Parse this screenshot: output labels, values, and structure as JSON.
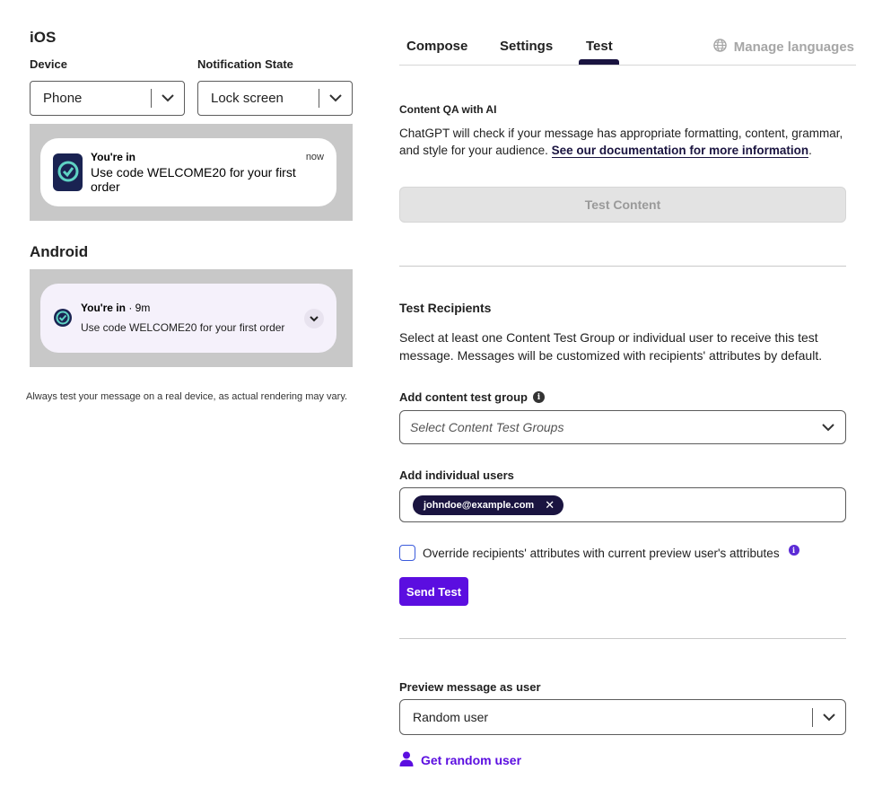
{
  "ios": {
    "title": "iOS",
    "device_label": "Device",
    "device_value": "Phone",
    "state_label": "Notification State",
    "state_value": "Lock screen",
    "notification": {
      "title": "You're in",
      "body": "Use code WELCOME20 for your first order",
      "time": "now"
    }
  },
  "android": {
    "title": "Android",
    "notification": {
      "title": "You're in",
      "time": "· 9m",
      "body": "Use code WELCOME20 for your first order"
    }
  },
  "disclaimer": "Always test your message on a real device, as actual rendering may vary.",
  "tabs": {
    "compose": "Compose",
    "settings": "Settings",
    "test": "Test",
    "manage_languages": "Manage languages",
    "active": "Test"
  },
  "content_qa": {
    "title": "Content QA with AI",
    "description": "ChatGPT will check if your message has appropriate formatting, content, grammar, and style for your audience. ",
    "link_text": "See our documentation for more information",
    "after_link": ".",
    "button": "Test Content"
  },
  "test_recipients": {
    "title": "Test Recipients",
    "description": "Select at least one Content Test Group or individual user to receive this test message. Messages will be customized with recipients' attributes by default.",
    "group_label": "Add content test group",
    "group_placeholder": "Select Content Test Groups",
    "users_label": "Add individual users",
    "users": [
      "johndoe@example.com"
    ],
    "override_label": "Override recipients' attributes with current preview user's attributes",
    "override_checked": false,
    "send_button": "Send Test"
  },
  "preview_user": {
    "label": "Preview message as user",
    "value": "Random user",
    "random_link": "Get random user"
  },
  "colors": {
    "accent": "#5b0ee0",
    "navy": "#1a1440",
    "preview_bg": "#c8c8c8"
  }
}
